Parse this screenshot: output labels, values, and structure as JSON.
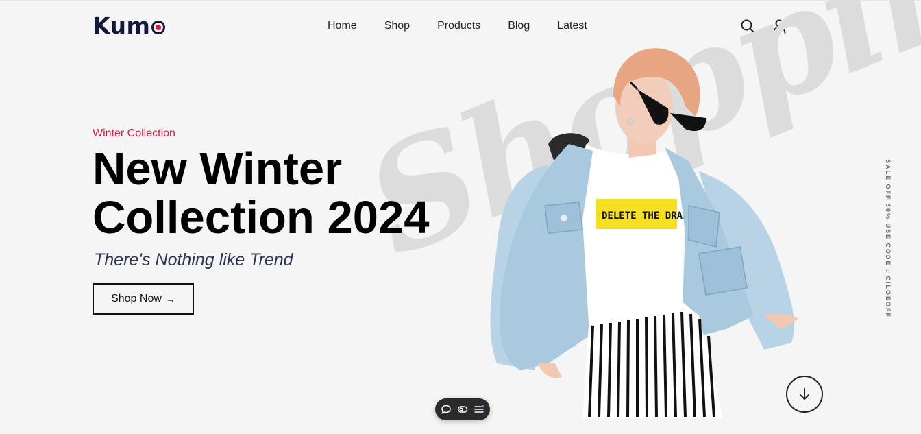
{
  "brand": {
    "name": "Kum",
    "accent": "#e3173e",
    "ink": "#14183a"
  },
  "nav": {
    "items": [
      {
        "label": "Home"
      },
      {
        "label": "Shop"
      },
      {
        "label": "Products"
      },
      {
        "label": "Blog"
      },
      {
        "label": "Latest"
      }
    ]
  },
  "header_icons": [
    "search-icon",
    "user-icon",
    "cart-icon"
  ],
  "hero": {
    "eyebrow": "Winter Collection",
    "headline_line1": "New Winter",
    "headline_line2": "Collection 2024",
    "subline": "There's Nothing like Trend",
    "cta_label": "Shop Now",
    "cta_arrow": "→",
    "script_watermark": "Shopping",
    "shirt_text": "DELETE THE DRAMA"
  },
  "side_promo": "SALE OFF 30% USE CODE : CILOEOFF",
  "toolbar_icons": [
    "comment-icon",
    "eye-icon",
    "menu-icon"
  ]
}
